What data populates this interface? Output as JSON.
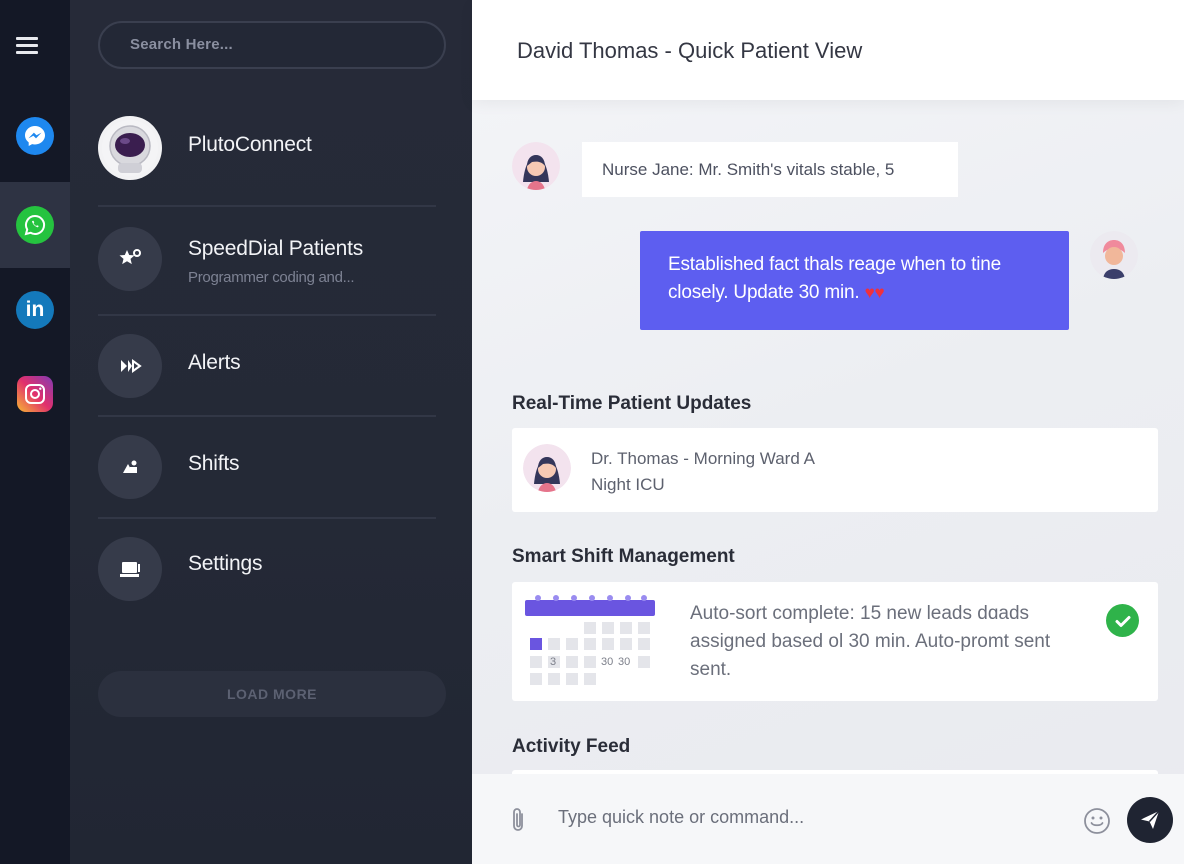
{
  "rail": {
    "items": [
      {
        "icon": "messenger-icon"
      },
      {
        "icon": "whatsapp-icon"
      },
      {
        "icon": "linkedin-icon"
      },
      {
        "icon": "instagram-icon"
      }
    ],
    "active": "whatsapp"
  },
  "panel": {
    "search_placeholder": "Search Here...",
    "contacts": [
      {
        "name": "PlutoConnect",
        "icon": "astronaut-avatar"
      },
      {
        "name": "SpeedDial Patients",
        "subtitle": "Programmer coding and...",
        "icon": "star-icon"
      },
      {
        "name": "Alerts",
        "icon": "alerts-icon"
      },
      {
        "name": "Shifts",
        "icon": "shifts-icon"
      },
      {
        "name": "Settings",
        "icon": "laptop-icon"
      }
    ],
    "load_more": "LOAD MORE"
  },
  "main": {
    "title": "David Thomas - Quick Patient View",
    "messages": {
      "incoming": "Nurse Jane: Mr. Smith's vitals stable, 5",
      "outgoing": "Established fact thals reage when to tine closely. Update 30 min.",
      "outgoing_emoji": "♥♥"
    },
    "updates": {
      "title": "Real-Time Patient Updates",
      "line1": "Dr. Thomas - Morning Ward A",
      "line2": "Night ICU"
    },
    "shifts": {
      "title": "Smart Shift Management",
      "text": "Auto-sort complete: 15 new leads dɑads assigned based ol 30 min. Auto-promt sent sent.",
      "calendar_labels": [
        "3",
        "30",
        "30"
      ]
    },
    "activity": {
      "title": "Activity Feed"
    },
    "compose": {
      "placeholder": "Type quick note or command..."
    },
    "colors": {
      "accent": "#5d5ef0",
      "sidebar": "#242936",
      "success": "#2fb34a"
    }
  }
}
